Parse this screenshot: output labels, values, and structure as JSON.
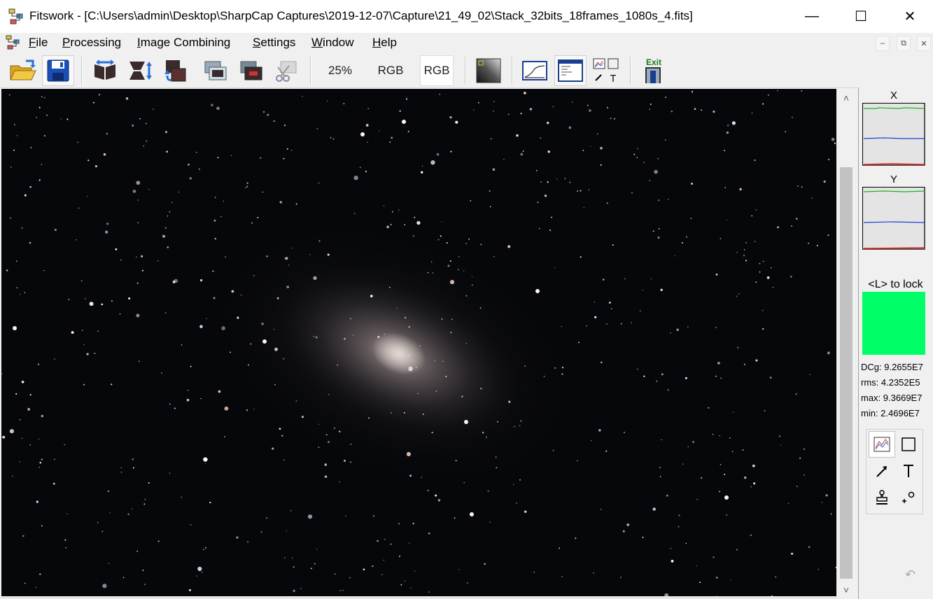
{
  "window": {
    "title": "Fitswork - [C:\\Users\\admin\\Desktop\\SharpCap Captures\\2019-12-07\\Capture\\21_49_02\\Stack_32bits_18frames_1080s_4.fits]",
    "minimize": "—",
    "maximize": "☐",
    "close": "✕"
  },
  "menu": {
    "items": [
      "File",
      "Processing",
      "Image Combining",
      "Settings",
      "Window",
      "Help"
    ],
    "mdi": {
      "minimize": "–",
      "restore": "⧉",
      "close": "✕"
    }
  },
  "toolbar": {
    "zoom": "25%",
    "mode1": "RGB",
    "mode2": "RGB",
    "exit": "Exit"
  },
  "panel": {
    "x_label": "X",
    "y_label": "Y",
    "lock_hint": "<L> to lock",
    "sample_color": "#00ff66",
    "stats": [
      "DCg: 9.2655E7",
      "rms: 4.2352E5",
      "max: 9.3669E7",
      "min: 2.4696E7"
    ],
    "undo": "↶"
  },
  "colors": {
    "profile_green": "#1fb41f",
    "profile_blue": "#1f3fd6",
    "profile_red": "#e01f1f"
  }
}
